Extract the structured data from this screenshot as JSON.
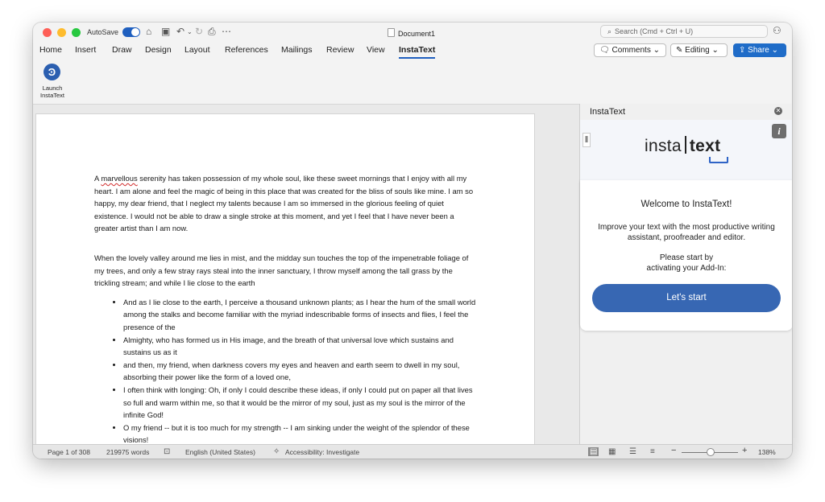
{
  "titlebar": {
    "autosave_label": "AutoSave",
    "document_title": "Document1",
    "search_placeholder": "Search (Cmd + Ctrl + U)"
  },
  "menu": {
    "tabs": [
      {
        "label": "Home"
      },
      {
        "label": "Insert"
      },
      {
        "label": "Draw"
      },
      {
        "label": "Design"
      },
      {
        "label": "Layout"
      },
      {
        "label": "References"
      },
      {
        "label": "Mailings"
      },
      {
        "label": "Review"
      },
      {
        "label": "View"
      },
      {
        "label": "InstaText",
        "active": true
      }
    ],
    "comments_label": "Comments",
    "editing_label": "Editing",
    "share_label": "Share"
  },
  "ribbon": {
    "launch_label_1": "Launch",
    "launch_label_2": "InstaText"
  },
  "document": {
    "p1_word": "marvellous",
    "p1_prefix": "A ",
    "p1_rest": " serenity has taken possession of my whole soul, like these sweet mornings that I enjoy with all my heart. I am alone and feel the magic of being in this place that was created for the bliss of souls like mine. I am so happy, my dear friend, that I neglect my talents because I am so immersed in the glorious feeling of quiet existence. I would not be able to draw a single stroke at this moment, and yet I feel that I have never been a greater artist than I am now.",
    "p2": "When the lovely valley around me lies in mist, and the midday sun touches the top of the impenetrable foliage of my trees, and only a few stray rays steal into the inner sanctuary, I throw myself among the tall grass by the trickling stream; and while I lie close to the earth",
    "bullets": [
      "And as I lie close to the earth, I perceive a thousand unknown plants; as I hear the hum of the small world among the stalks and become familiar with the myriad indescribable forms of insects and flies, I feel the presence of the",
      "Almighty, who has formed us in His image, and the breath of that universal love which sustains and sustains us as it",
      " and then, my friend, when darkness covers my eyes and heaven and earth seem to dwell in my soul, absorbing their power like the form of a loved one,",
      "I often think with longing: Oh, if only I could describe these ideas, if only I could put on paper all that lives so full and warm within me, so that it would be the mirror of my soul, just as my soul is the mirror of the infinite God!",
      "O my friend -- but it is too much for my strength -- I am sinking under the weight of the splendor of these visions!"
    ]
  },
  "pane": {
    "title": "InstaText",
    "logo_left": "insta",
    "logo_right": "text",
    "welcome": "Welcome to InstaText!",
    "improve": "Improve your text with the most productive writing assistant, proofreader and editor.",
    "please_1": "Please start by",
    "please_2": "activating your Add-In:",
    "start_button": "Let's start"
  },
  "statusbar": {
    "page": "Page 1 of 308",
    "words": "219975 words",
    "language": "English (United States)",
    "accessibility": "Accessibility: Investigate",
    "zoom": "138%"
  },
  "colors": {
    "accent": "#1f6cc8",
    "start_button": "#3767b3"
  },
  "icons": [
    "home-icon",
    "save-icon",
    "undo-icon",
    "redo-icon",
    "print-icon",
    "more-icon",
    "search-icon",
    "people-icon",
    "comment-icon",
    "pencil-icon",
    "share-icon",
    "instatext-icon",
    "close-icon",
    "info-icon",
    "spelling-icon",
    "accessibility-icon",
    "view-icons"
  ]
}
